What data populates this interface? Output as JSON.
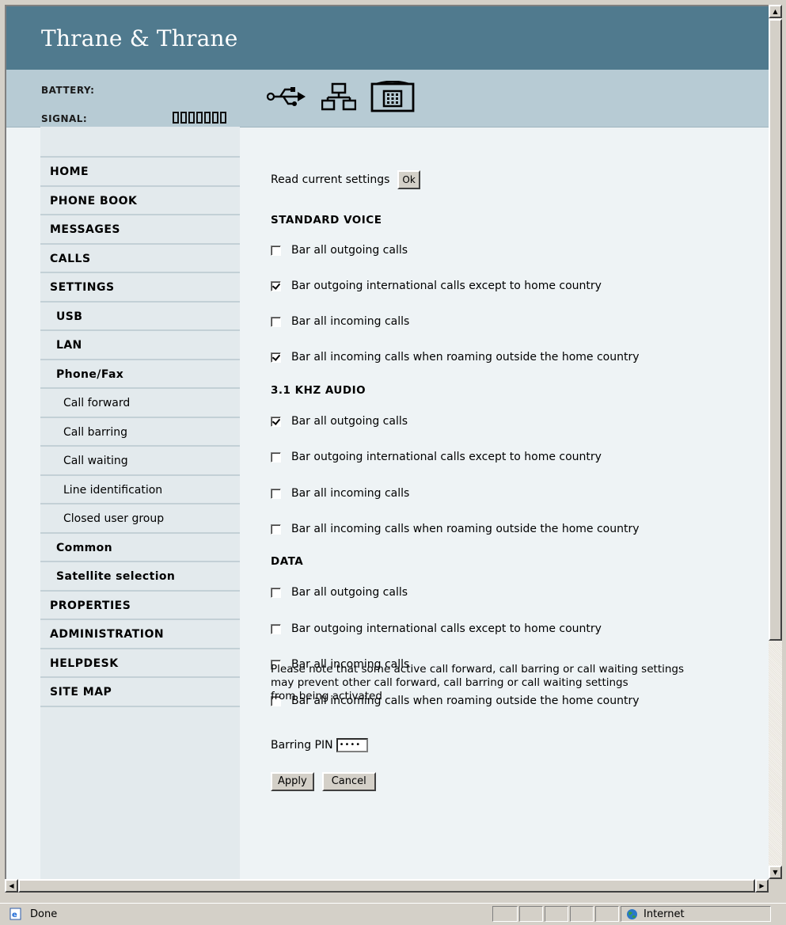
{
  "brand": "Thrane & Thrane",
  "status": {
    "battery_label": "BATTERY:",
    "signal_label": "SIGNAL:",
    "signal_bars": 7,
    "interface_icons": [
      "usb-icon",
      "lan-icon",
      "phone-icon"
    ]
  },
  "nav": [
    {
      "label": "HOME",
      "level": 0
    },
    {
      "label": "PHONE BOOK",
      "level": 0
    },
    {
      "label": "MESSAGES",
      "level": 0
    },
    {
      "label": "CALLS",
      "level": 0
    },
    {
      "label": "SETTINGS",
      "level": 0
    },
    {
      "label": "USB",
      "level": 1
    },
    {
      "label": "LAN",
      "level": 1
    },
    {
      "label": "Phone/Fax",
      "level": 1
    },
    {
      "label": "Call forward",
      "level": 2
    },
    {
      "label": "Call barring",
      "level": 2
    },
    {
      "label": "Call waiting",
      "level": 2
    },
    {
      "label": "Line identification",
      "level": 2
    },
    {
      "label": "Closed user group",
      "level": 2
    },
    {
      "label": "Common",
      "level": 1
    },
    {
      "label": "Satellite selection",
      "level": 1
    },
    {
      "label": "PROPERTIES",
      "level": 0
    },
    {
      "label": "ADMINISTRATION",
      "level": 0
    },
    {
      "label": "HELPDESK",
      "level": 0
    },
    {
      "label": "SITE MAP",
      "level": 0
    }
  ],
  "read_settings": {
    "label": "Read current settings",
    "button": "Ok"
  },
  "sections": [
    {
      "title": "STANDARD VOICE",
      "options": [
        {
          "label": "Bar all outgoing calls",
          "checked": false
        },
        {
          "label": "Bar outgoing international calls except to home country",
          "checked": true
        },
        {
          "label": "Bar all incoming calls",
          "checked": false
        },
        {
          "label": "Bar all incoming calls when roaming outside the home country",
          "checked": true
        }
      ]
    },
    {
      "title": "3.1 KHZ AUDIO",
      "options": [
        {
          "label": "Bar all outgoing calls",
          "checked": true
        },
        {
          "label": "Bar outgoing international calls except to home country",
          "checked": false
        },
        {
          "label": "Bar all incoming calls",
          "checked": false
        },
        {
          "label": "Bar all incoming calls when roaming outside the home country",
          "checked": false
        }
      ]
    },
    {
      "title": "DATA",
      "options": [
        {
          "label": "Bar all outgoing calls",
          "checked": false
        },
        {
          "label": "Bar outgoing international calls except to home country",
          "checked": false
        },
        {
          "label": "Bar all incoming calls",
          "checked": false
        },
        {
          "label": "Bar all incoming calls when roaming outside the home country",
          "checked": false
        }
      ]
    }
  ],
  "pin": {
    "label": "Barring PIN",
    "value": "••••"
  },
  "buttons": {
    "apply": "Apply",
    "cancel": "Cancel"
  },
  "note": "Please note that some active call forward, call barring or call waiting settings\nmay prevent other call forward, call barring or call waiting settings\nfrom being activated",
  "browser_status": {
    "left": "Done",
    "zone": "Internet"
  },
  "colors": {
    "header": "#507a8e",
    "status_band": "#b7cbd4",
    "sidebar": "#e3eaed",
    "content_bg": "#eef3f5"
  }
}
